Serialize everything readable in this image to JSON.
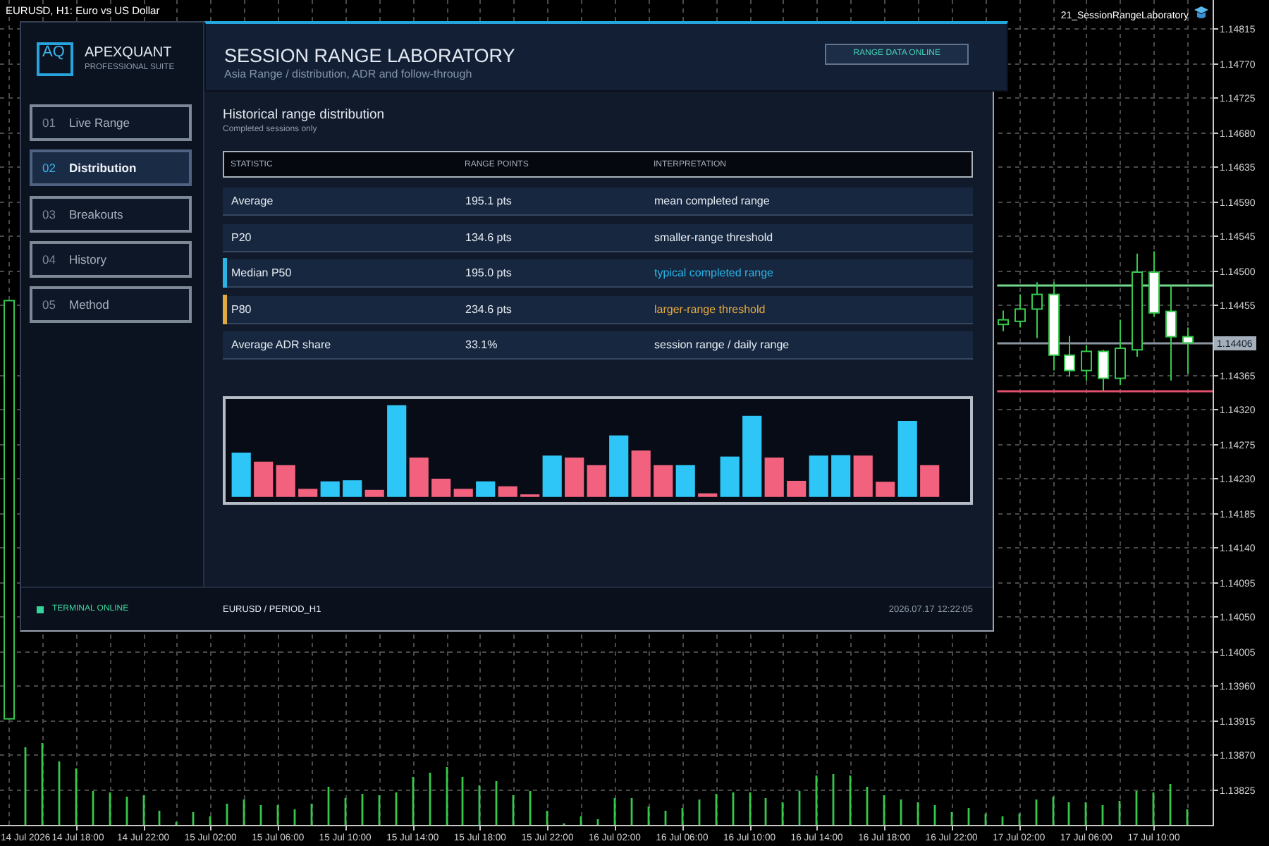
{
  "chart_window": {
    "indicator": "21_SessionRangeLaboratory",
    "start_date": "14 Jul 2026",
    "chart_data": {
      "type": "candlestick",
      "title": "EURUSD, H1: Euro vs US Dollar",
      "categories": [
        null,
        null,
        null,
        null,
        "14 Jul 18:00",
        null,
        null,
        null,
        "14 Jul 22:00",
        null,
        null,
        null,
        "15 Jul 02:00",
        null,
        null,
        null,
        "15 Jul 06:00",
        null,
        null,
        null,
        "15 Jul 10:00",
        null,
        null,
        null,
        "15 Jul 14:00",
        null,
        null,
        null,
        "15 Jul 18:00",
        null,
        null,
        null,
        "15 Jul 22:00",
        null,
        null,
        null,
        "16 Jul 02:00",
        null,
        null,
        null,
        "16 Jul 06:00",
        null,
        null,
        null,
        "16 Jul 10:00",
        null,
        null,
        null,
        "16 Jul 14:00",
        null,
        null,
        null,
        "16 Jul 18:00",
        null,
        null,
        null,
        "16 Jul 22:00",
        null,
        null,
        null,
        "17 Jul 02:00",
        null,
        null,
        null,
        "17 Jul 06:00",
        null,
        null,
        null,
        "17 Jul 10:00",
        null,
        null,
        null
      ],
      "ohlc": [
        [
          1.13917,
          1.14461,
          1.13917,
          1.14461
        ],
        null,
        null,
        null,
        null,
        null,
        null,
        null,
        null,
        null,
        null,
        null,
        null,
        null,
        null,
        null,
        null,
        null,
        null,
        null,
        null,
        null,
        null,
        null,
        null,
        null,
        null,
        null,
        null,
        null,
        null,
        null,
        null,
        null,
        null,
        null,
        null,
        null,
        null,
        null,
        null,
        null,
        null,
        null,
        null,
        null,
        null,
        null,
        null,
        null,
        null,
        null,
        null,
        null,
        null,
        null,
        null,
        null,
        null,
        [
          1.1443,
          1.14448,
          1.14421,
          1.14436
        ],
        [
          1.14434,
          1.14469,
          1.14426,
          1.1445
        ],
        [
          1.1445,
          1.14485,
          1.14412,
          1.14469
        ],
        [
          1.14469,
          1.14485,
          1.1437,
          1.1439
        ],
        [
          1.1439,
          1.14415,
          1.14362,
          1.1437
        ],
        [
          1.1437,
          1.14403,
          1.14357,
          1.14395
        ],
        [
          1.14395,
          1.14397,
          1.14344,
          1.1436
        ],
        [
          1.1436,
          1.14436,
          1.14351,
          1.14399
        ],
        [
          1.14397,
          1.14522,
          1.14388,
          1.14498
        ],
        [
          1.14498,
          1.14525,
          1.1444,
          1.14445
        ],
        [
          1.14447,
          1.1448,
          1.14357,
          1.14414
        ],
        [
          1.14414,
          1.14426,
          1.14366,
          1.14406
        ],
        null
      ],
      "ylim": [
        1.13779,
        1.14852
      ],
      "yticks": [
        {
          "value": 1.14815,
          "label": "1.14815"
        },
        {
          "value": 1.1477,
          "label": "1.14770"
        },
        {
          "value": 1.14725,
          "label": "1.14725"
        },
        {
          "value": 1.1468,
          "label": "1.14680"
        },
        {
          "value": 1.14635,
          "label": "1.14635"
        },
        {
          "value": 1.1459,
          "label": "1.14590"
        },
        {
          "value": 1.14545,
          "label": "1.14545"
        },
        {
          "value": 1.145,
          "label": "1.14500"
        },
        {
          "value": 1.14455,
          "label": "1.14455"
        },
        {
          "value": 1.14365,
          "label": "1.14365"
        },
        {
          "value": 1.1432,
          "label": "1.14320"
        },
        {
          "value": 1.14275,
          "label": "1.14275"
        },
        {
          "value": 1.1423,
          "label": "1.14230"
        },
        {
          "value": 1.14185,
          "label": "1.14185"
        },
        {
          "value": 1.1414,
          "label": "1.14140"
        },
        {
          "value": 1.14095,
          "label": "1.14095"
        },
        {
          "value": 1.1405,
          "label": "1.14050"
        },
        {
          "value": 1.14005,
          "label": "1.14005"
        },
        {
          "value": 1.1396,
          "label": "1.13960"
        },
        {
          "value": 1.13915,
          "label": "1.13915"
        },
        {
          "value": 1.1387,
          "label": "1.13870"
        },
        {
          "value": 1.13825,
          "label": "1.13825"
        }
      ],
      "grid": true,
      "ref_lines": [
        {
          "axis": "y",
          "value": 1.14406,
          "label": "1.14406",
          "color": "#8b95a1"
        },
        {
          "axis": "y",
          "value": 1.14482,
          "color": "#74d98f"
        },
        {
          "axis": "y",
          "value": 1.14344,
          "color": "#e4506c"
        }
      ]
    }
  },
  "panel": {
    "logo": {
      "mark": "AQ",
      "name": "APEXQUANT",
      "tagline": "PROFESSIONAL SUITE"
    },
    "nav": [
      {
        "number": "01",
        "label": "Live Range",
        "selected": false
      },
      {
        "number": "02",
        "label": "Distribution",
        "selected": true
      },
      {
        "number": "03",
        "label": "Breakouts",
        "selected": false
      },
      {
        "number": "04",
        "label": "History",
        "selected": false
      },
      {
        "number": "05",
        "label": "Method",
        "selected": false
      }
    ],
    "header": {
      "title": "SESSION RANGE LABORATORY",
      "subtitle": "Asia Range / distribution, ADR and follow-through",
      "badge": "RANGE DATA ONLINE"
    },
    "section": {
      "title": "Historical range distribution",
      "note": "Completed sessions only"
    },
    "table": {
      "columns": [
        "STATISTIC",
        "RANGE POINTS",
        "INTERPRETATION"
      ],
      "rows": [
        {
          "statistic": "Average",
          "range_points": "195.1 pts",
          "interpretation": "mean completed range",
          "highlighted": false
        },
        {
          "statistic": "P20",
          "range_points": "134.6 pts",
          "interpretation": "smaller-range threshold",
          "highlighted": false
        },
        {
          "statistic": "Median P50",
          "range_points": "195.0 pts",
          "interpretation": "typical completed range",
          "highlighted": true,
          "color": "#2ab4e6"
        },
        {
          "statistic": "P80",
          "range_points": "234.6 pts",
          "interpretation": "larger-range threshold",
          "highlighted": true,
          "color": "#e2a93e"
        },
        {
          "statistic": "Average ADR share",
          "range_points": "33.1%",
          "interpretation": "session range / daily range",
          "highlighted": false
        }
      ]
    },
    "status_bar": {
      "status": "TERMINAL ONLINE",
      "symbol": "EURUSD / PERIOD_H1",
      "timestamp": "2026.07.17 12:22:05"
    }
  }
}
